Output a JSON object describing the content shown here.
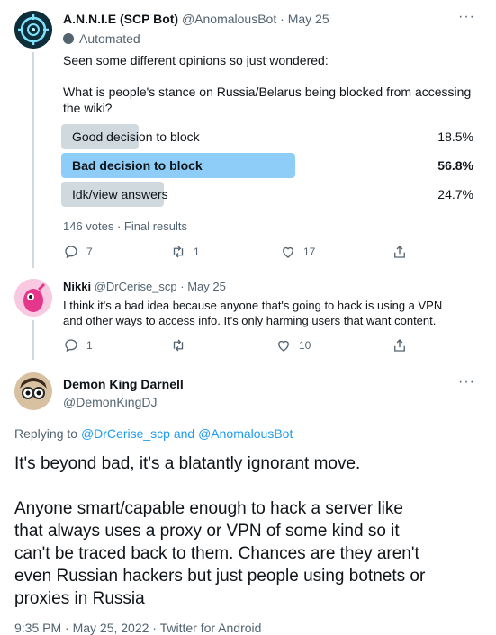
{
  "tweet1": {
    "display_name": "A.N.N.I.E (SCP Bot)",
    "handle": "@AnomalousBot",
    "date": "May 25",
    "automated_label": "Automated",
    "text_line1": "Seen some different opinions so just wondered:",
    "text_line2": "What is people's stance on Russia/Belarus being blocked from accessing",
    "text_line3": "the wiki?",
    "poll": {
      "options": [
        {
          "label": "Good decision to block",
          "pct_text": "18.5%",
          "value": 18.5
        },
        {
          "label": "Bad decision to block",
          "pct_text": "56.8%",
          "value": 56.8
        },
        {
          "label": "Idk/view answers",
          "pct_text": "24.7%",
          "value": 24.7
        }
      ],
      "summary": "146 votes · Final results"
    },
    "actions": {
      "replies": "7",
      "retweets": "1",
      "likes": "17"
    }
  },
  "tweet2": {
    "display_name": "Nikki",
    "handle": "@DrCerise_scp",
    "date": "May 25",
    "text_line1": "I think it's a bad idea because anyone that's going to hack is using a VPN",
    "text_line2": "and other ways to access info. It's only harming users that want content.",
    "actions": {
      "replies": "1",
      "retweets": "",
      "likes": "10"
    }
  },
  "main_tweet": {
    "display_name": "Demon King Darnell",
    "handle": "@DemonKingDJ",
    "replying_prefix": "Replying to ",
    "replying_users": "@DrCerise_scp and @AnomalousBot",
    "para1": "It's beyond bad, it's a blatantly ignorant move.",
    "para2_l1": "Anyone smart/capable enough to hack a server like",
    "para2_l2": "that always uses a proxy or VPN of some kind so it",
    "para2_l3": "can't be traced back to them. Chances are they aren't",
    "para2_l4": "even Russian hackers but just people using botnets or",
    "para2_l5": "proxies in Russia",
    "footer": "9:35 PM · May 25, 2022 · Twitter for Android"
  },
  "more_glyph": "···",
  "colors": {
    "accent": "#1d9bf0",
    "poll_winner": "#8ecdf8",
    "poll_other": "#cfd9de",
    "muted": "#536471"
  },
  "icons": [
    "reply-icon",
    "retweet-icon",
    "like-icon",
    "share-icon",
    "more-icon",
    "robot-icon"
  ]
}
